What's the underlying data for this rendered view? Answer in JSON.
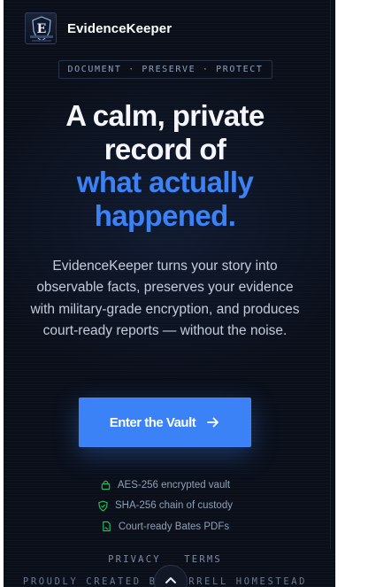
{
  "header": {
    "brand_name": "EvidenceKeeper",
    "logo_icon": "shield-e-logo-icon"
  },
  "hero": {
    "tagline": "DOCUMENT · PRESERVE · PROTECT",
    "headline_line1": "A calm, private",
    "headline_line2": "record of",
    "headline_line3": "what actually",
    "headline_line4": "happened.",
    "lede": "EvidenceKeeper turns your story into observable facts, preserves your evidence with military-grade encryption, and produces court-ready reports — without the noise.",
    "cta_label": "Enter the Vault",
    "cta_icon": "arrow-right-icon"
  },
  "features": [
    {
      "icon": "lock-icon",
      "label": "AES-256 encrypted vault"
    },
    {
      "icon": "shield-check-icon",
      "label": "SHA-256 chain of custody"
    },
    {
      "icon": "file-signature-icon",
      "label": "Court-ready Bates PDFs"
    }
  ],
  "footer": {
    "privacy_label": "PRIVACY",
    "terms_label": "TERMS",
    "credit": "PROUDLY CREATED BY FERRELL HOMESTEAD"
  },
  "colors": {
    "background": "#0a0f1a",
    "accent": "#3b82f6",
    "accent_icon": "#22c55e",
    "text_primary": "#f4f6fb",
    "text_muted": "#8fa0b8"
  }
}
